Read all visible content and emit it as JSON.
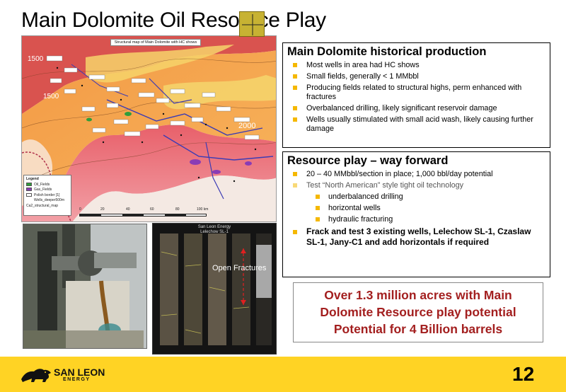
{
  "slide": {
    "title": "Main Dolomite Oil Resource Play",
    "page_number": "12"
  },
  "map": {
    "title": "Structural map of Main Dolomite with HC shows",
    "contour_labels": [
      "1500",
      "1500",
      "2000"
    ],
    "legend": {
      "title": "Legend",
      "items": [
        "Oil_Fields",
        "Gas_Fields",
        "Polish border [1]",
        "Wells_deeper500m",
        "Ca2_structural_map"
      ]
    },
    "scale_labels": [
      "0",
      "20",
      "40",
      "60",
      "80",
      "100 km"
    ],
    "colors": {
      "oil_fields": "#2f9e3b",
      "gas_fields": "#8a3cb5"
    }
  },
  "core_photo": {
    "header_company": "San Leon Energy",
    "header_well": "Lelechow SL-1",
    "footer": "",
    "overlay_label": "Open Fractures"
  },
  "box1": {
    "heading": "Main Dolomite historical production",
    "bullets": [
      "Most wells in area had HC shows",
      "Small fields, generally < 1 MMbbl",
      "Producing fields related to structural highs, perm enhanced with fractures",
      "Overbalanced drilling, likely significant reservoir damage",
      "Wells usually stimulated with small acid wash, likely causing further damage"
    ]
  },
  "box2": {
    "heading": "Resource play – way forward",
    "bullets": [
      "20 – 40 MMbbl/section in place; 1,000 bbl/day potential",
      "Test “North American” style tight oil technology",
      "underbalanced drilling",
      "horizontal wells",
      "hydraulic fracturing",
      "Frack and test 3 existing wells, Lelechow SL-1, Czaslaw SL-1, Jany-C1 and add horizontals if required"
    ]
  },
  "callout": {
    "line1": "Over 1.3 million acres with Main",
    "line2": "Dolomite Resource play potential",
    "line3": "Potential for 4 Billion barrels"
  },
  "footer": {
    "logo_name": "SAN LEON",
    "logo_sub": "ENERGY",
    "background": "#ffd324"
  }
}
